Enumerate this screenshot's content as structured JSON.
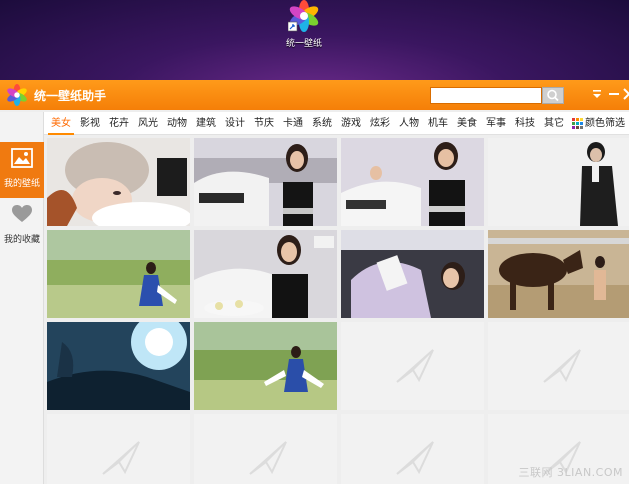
{
  "desktop": {
    "icon_label": "统一壁纸"
  },
  "app": {
    "title": "统一壁纸助手",
    "search_placeholder": "",
    "search_value": "",
    "accent_color": "#f7860c"
  },
  "categories": {
    "items": [
      "美女",
      "影视",
      "花卉",
      "风光",
      "动物",
      "建筑",
      "设计",
      "节庆",
      "卡通",
      "系统",
      "游戏",
      "炫彩",
      "人物",
      "机车",
      "美食",
      "军事",
      "科技",
      "其它"
    ],
    "active": "美女",
    "color_filter_label": "颜色筛选"
  },
  "sidebar": {
    "items": [
      {
        "label": "我的壁纸",
        "icon": "picture-icon",
        "active": true
      },
      {
        "label": "我的收藏",
        "icon": "heart-icon",
        "active": false
      }
    ]
  },
  "wallpapers": {
    "thumbnails": [
      {
        "subject": "woman-knit-hat"
      },
      {
        "subject": "model-white-car"
      },
      {
        "subject": "model-car-show"
      },
      {
        "subject": "man-black-suit"
      },
      {
        "subject": "woman-grass-field"
      },
      {
        "subject": "model-car-flowers"
      },
      {
        "subject": "woman-car-seat"
      },
      {
        "subject": "woman-with-horse"
      },
      {
        "subject": "man-blue-light"
      },
      {
        "subject": "woman-grass-field-2"
      }
    ],
    "placeholder_count": 10
  },
  "watermark": "三联网 3LIAN.COM"
}
